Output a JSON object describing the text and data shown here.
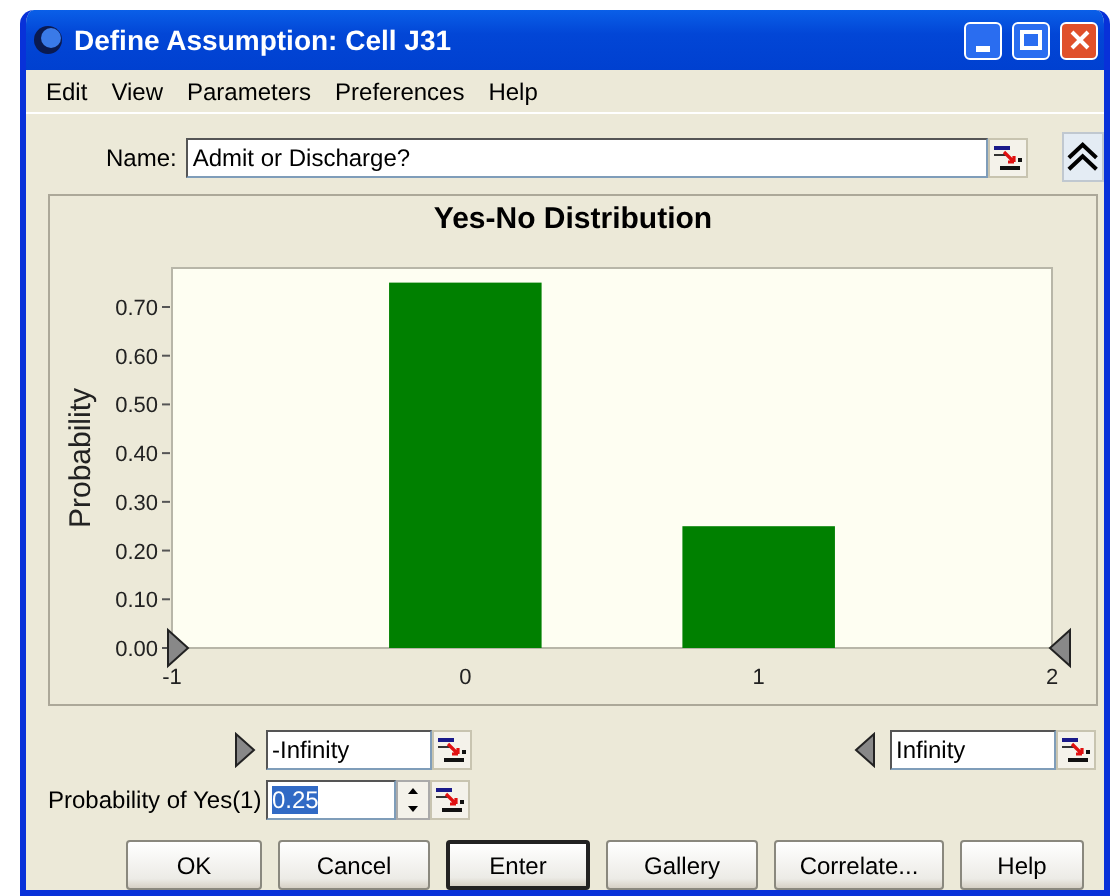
{
  "window": {
    "title": "Define Assumption: Cell J31"
  },
  "menu": [
    "Edit",
    "View",
    "Parameters",
    "Preferences",
    "Help"
  ],
  "name_field": {
    "label": "Name:",
    "value": "Admit or Discharge?"
  },
  "chart": {
    "title": "Yes-No Distribution",
    "chart_data": {
      "type": "bar",
      "ylabel": "Probability",
      "x": [
        0,
        1
      ],
      "values": [
        0.75,
        0.25
      ],
      "xlim": [
        -1,
        2
      ],
      "ylim": [
        0,
        0.78
      ],
      "xticks": [
        -1,
        0,
        1,
        2
      ],
      "yticks": [
        {
          "value": 0,
          "label": "0.00"
        },
        {
          "value": 0.1,
          "label": "0.10"
        },
        {
          "value": 0.2,
          "label": "0.20"
        },
        {
          "value": 0.3,
          "label": "0.30"
        },
        {
          "value": 0.4,
          "label": "0.40"
        },
        {
          "value": 0.5,
          "label": "0.50"
        },
        {
          "value": 0.6,
          "label": "0.60"
        },
        {
          "value": 0.7,
          "label": "0.70"
        }
      ]
    }
  },
  "bounds": {
    "lower": "-Infinity",
    "upper": "Infinity"
  },
  "probability": {
    "label": "Probability of Yes(1)",
    "value": "0.25",
    "highlighted": true
  },
  "buttons": [
    {
      "label": "OK",
      "default": false
    },
    {
      "label": "Cancel",
      "default": false
    },
    {
      "label": "Enter",
      "default": true
    },
    {
      "label": "Gallery",
      "default": false
    },
    {
      "label": "Correlate...",
      "default": false
    },
    {
      "label": "Help",
      "default": false
    }
  ]
}
